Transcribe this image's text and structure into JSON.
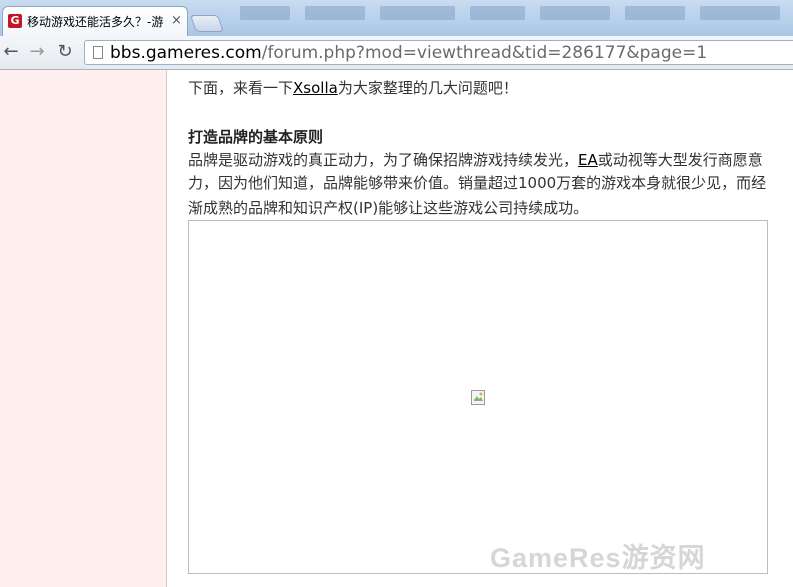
{
  "browser": {
    "tab": {
      "favicon_letter": "G",
      "title": "移动游戏还能活多久？-游",
      "close": "×"
    },
    "nav": {
      "back": "←",
      "forward": "→",
      "reload": "↻"
    },
    "address": {
      "host": "bbs.gameres.com",
      "path": "/forum.php?mod=viewthread&tid=286177&page=1"
    }
  },
  "article": {
    "intro_prefix": "下面，来看一下",
    "intro_link": "Xsolla",
    "intro_suffix": "为大家整理的几大问题吧！",
    "section_heading": "打造品牌的基本原则",
    "para_line1_a": "品牌是驱动游戏的真正动力，为了确保招牌游戏持续发光，",
    "para_line1_link": "EA",
    "para_line1_b": "或动视等大型发行商愿意",
    "para_line2": "力，因为他们知道，品牌能够带来价值。销量超过1000万套的游戏本身就很少见，而经",
    "para_line3": "渐成熟的品牌和知识产权(IP)能够让这些游戏公司持续成功。"
  },
  "watermark": "GameRes游资网",
  "colors": {
    "left_pane": "#fff0ef",
    "favicon": "#c0182a",
    "tabstrip": "#aac6e6"
  }
}
